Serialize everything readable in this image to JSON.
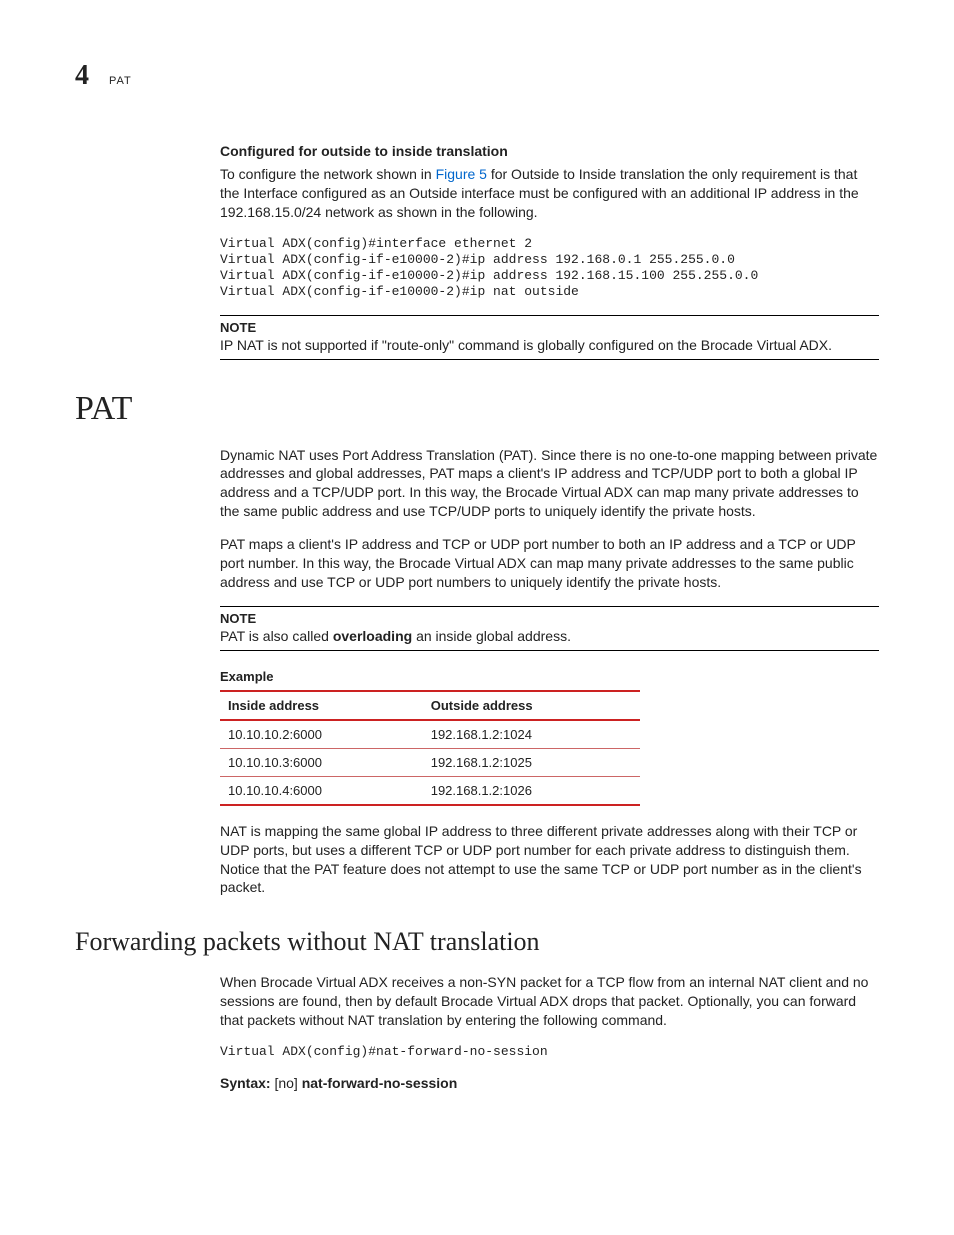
{
  "header": {
    "chapter_number": "4",
    "page_tag": "PAT"
  },
  "s1": {
    "heading": "Configured for outside to inside translation",
    "para_before_link": "To configure the network shown in ",
    "link_text": "Figure 5",
    "para_after_link": " for Outside to Inside translation the only requirement is that the Interface configured as an Outside interface must be configured with an additional IP address in the 192.168.15.0/24 network as shown in the following.",
    "code": "Virtual ADX(config)#interface ethernet 2\nVirtual ADX(config-if-e10000-2)#ip address 192.168.0.1 255.255.0.0\nVirtual ADX(config-if-e10000-2)#ip address 192.168.15.100 255.255.0.0\nVirtual ADX(config-if-e10000-2)#ip nat outside",
    "note_title": "NOTE",
    "note_body": "IP NAT is not supported if \"route-only\" command is globally configured on the Brocade Virtual ADX."
  },
  "pat": {
    "title": "PAT",
    "p1": "Dynamic NAT uses Port Address Translation (PAT). Since there is no one-to-one mapping between private addresses and global addresses, PAT maps a client's IP address and TCP/UDP port to both a global IP address and a TCP/UDP port. In this way, the Brocade Virtual ADX can map many private addresses to the same public address and use TCP/UDP ports to uniquely identify the private hosts.",
    "p2": "PAT maps a client's IP address and TCP or UDP port number to both an IP address and a TCP or UDP port number. In this way, the Brocade Virtual ADX can map many private addresses to the same public address and use TCP or UDP port numbers to uniquely identify the private hosts.",
    "note_title": "NOTE",
    "note_pre": "PAT is also called ",
    "note_bold": "overloading",
    "note_post": " an inside global address.",
    "example_label": "Example",
    "table": {
      "h_inside": "Inside address",
      "h_outside": "Outside address",
      "rows": [
        {
          "inside": "10.10.10.2:6000",
          "outside": "192.168.1.2:1024"
        },
        {
          "inside": "10.10.10.3:6000",
          "outside": "192.168.1.2:1025"
        },
        {
          "inside": "10.10.10.4:6000",
          "outside": "192.168.1.2:1026"
        }
      ]
    },
    "p3": "NAT is mapping the same global IP address to three different private addresses along with their TCP or UDP ports, but uses a different TCP or UDP port number for each private address to distinguish them. Notice that the PAT feature does not attempt to use the same TCP or UDP port number as in the client's packet."
  },
  "fwd": {
    "title": "Forwarding packets without NAT translation",
    "p1": "When Brocade Virtual ADX receives a non-SYN packet for a TCP flow from an internal NAT client and no sessions are found, then by default Brocade Virtual ADX drops that packet. Optionally, you can forward that packets without NAT translation by entering the following command.",
    "code": "Virtual ADX(config)#nat-forward-no-session",
    "syntax_label": "Syntax:",
    "syntax_opt": "  [no] ",
    "syntax_cmd": "nat-forward-no-session"
  }
}
